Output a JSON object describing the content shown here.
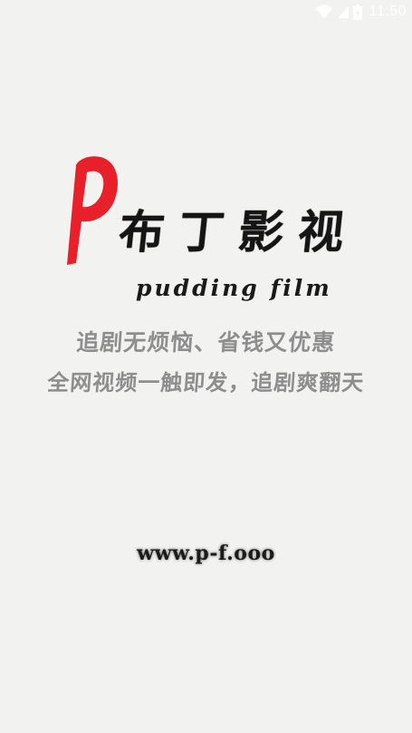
{
  "status_bar": {
    "time": "11:50",
    "icons": [
      "wifi-icon",
      "signal-icon",
      "battery-charging-icon"
    ]
  },
  "logo": {
    "letter": "P",
    "title": "布丁影视",
    "subtitle": "pudding film",
    "accent_color": "#e8202a"
  },
  "slogans": {
    "line1": "追剧无烦恼、省钱又优惠",
    "line2": "全网视频一触即发，追剧爽翻天"
  },
  "website": "www.p-f.ooo",
  "colors": {
    "background": "#f2f2f1",
    "slogan": "#8e8e8e",
    "text_dark": "#1b1b1b"
  }
}
